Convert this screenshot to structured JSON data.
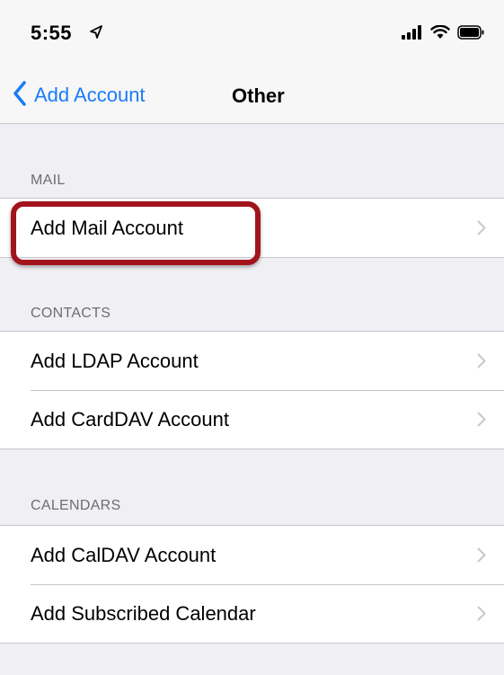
{
  "status_bar": {
    "time": "5:55",
    "icons": [
      "location-arrow-icon",
      "cellular-signal-icon",
      "wifi-icon",
      "battery-icon"
    ]
  },
  "navbar": {
    "back_label": "Add Account",
    "title": "Other"
  },
  "sections": [
    {
      "header": "MAIL",
      "items": [
        {
          "label": "Add Mail Account"
        }
      ]
    },
    {
      "header": "CONTACTS",
      "items": [
        {
          "label": "Add LDAP Account"
        },
        {
          "label": "Add CardDAV Account"
        }
      ]
    },
    {
      "header": "CALENDARS",
      "items": [
        {
          "label": "Add CalDAV Account"
        },
        {
          "label": "Add Subscribed Calendar"
        }
      ]
    }
  ],
  "colors": {
    "accent": "#1a7cf5",
    "highlight": "#a2141c",
    "background": "#efeff4",
    "separator": "#c8c7cc",
    "section_text": "#6d6d72",
    "chevron": "#c7c7cc"
  }
}
